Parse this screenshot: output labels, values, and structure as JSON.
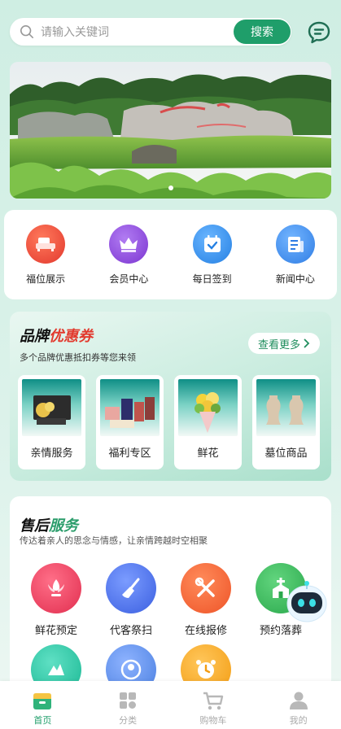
{
  "search": {
    "placeholder": "请输入关键词",
    "button": "搜索"
  },
  "quick_nav": [
    {
      "label": "福位展示",
      "icon": "sofa-icon",
      "color": "#ea4a3c"
    },
    {
      "label": "会员中心",
      "icon": "crown-icon",
      "color": "#8e49d9"
    },
    {
      "label": "每日签到",
      "icon": "calendar-check-icon",
      "color": "#2f8de8"
    },
    {
      "label": "新闻中心",
      "icon": "newspaper-icon",
      "color": "#3a86e6"
    }
  ],
  "coupon": {
    "title_black": "品牌",
    "title_red": "优惠券",
    "subtitle": "多个品牌优惠抵扣券等您来领",
    "more": "查看更多",
    "items": [
      {
        "label": "亲情服务"
      },
      {
        "label": "福利专区"
      },
      {
        "label": "鲜花"
      },
      {
        "label": "墓位商品"
      }
    ]
  },
  "after_sales": {
    "title_black": "售后",
    "title_green": "服务",
    "subtitle": "传达着亲人的思念与情感，让亲情跨越时空相聚",
    "items": [
      {
        "label": "鲜花预定",
        "icon": "flower-icon",
        "color": "#ec3f5e"
      },
      {
        "label": "代客祭扫",
        "icon": "broom-icon",
        "color": "#4a6fe6"
      },
      {
        "label": "在线报修",
        "icon": "wrench-icon",
        "color": "#f3673a"
      },
      {
        "label": "预约落葬",
        "icon": "chapel-icon",
        "color": "#3cbb62"
      },
      {
        "label": "",
        "icon": "tools-icon",
        "color": "#2ec9a7"
      },
      {
        "label": "",
        "icon": "globe-user-icon",
        "color": "#5b8ee8"
      },
      {
        "label": "",
        "icon": "alarm-clock-icon",
        "color": "#f5a623"
      }
    ]
  },
  "tabbar": [
    {
      "label": "首页",
      "icon": "home-icon",
      "active": true
    },
    {
      "label": "分类",
      "icon": "category-icon",
      "active": false
    },
    {
      "label": "购物车",
      "icon": "cart-icon",
      "active": false
    },
    {
      "label": "我的",
      "icon": "user-icon",
      "active": false
    }
  ]
}
